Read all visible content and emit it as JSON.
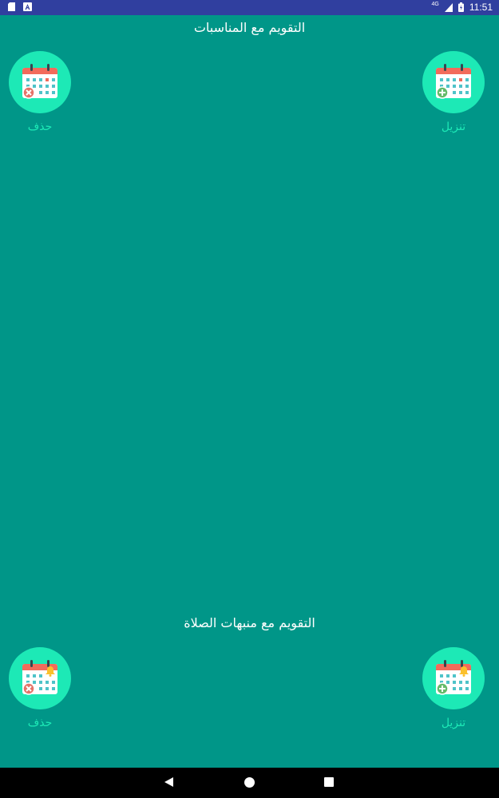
{
  "status_bar": {
    "left_icons": [
      "sd-card-icon",
      "app-notification-icon"
    ],
    "network": "4G",
    "time": "11:51"
  },
  "section_events": {
    "title": "التقويم مع المناسبات",
    "install_label": "تنزيل",
    "delete_label": "حذف"
  },
  "section_prayer": {
    "title": "التقويم مع منبهات الصلاة",
    "install_label": "تنزيل",
    "delete_label": "حذف"
  },
  "colors": {
    "background": "#009688",
    "status_bar": "#303f9f",
    "button_circle": "#1de9b6",
    "label": "#1de9b6",
    "calendar_header": "#f26b5b",
    "delete_badge": "#e57368",
    "add_badge": "#66bb6a",
    "bell": "#fbc02d"
  },
  "nav_bar": {
    "icons": [
      "back-icon",
      "home-icon",
      "recents-icon"
    ]
  }
}
